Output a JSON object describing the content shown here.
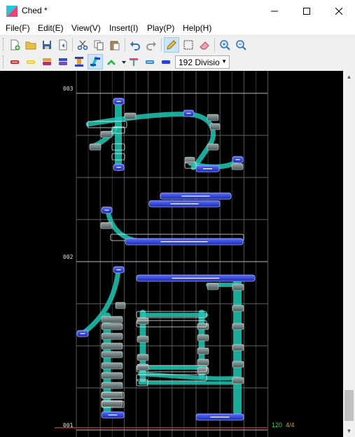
{
  "window": {
    "title": "Ched *"
  },
  "menu": {
    "items": [
      "File(F)",
      "Edit(E)",
      "View(V)",
      "Insert(I)",
      "Play(P)",
      "Help(H)"
    ]
  },
  "toolbar": {
    "division": "192 Divisio"
  },
  "score": {
    "measures": [
      "001",
      "002",
      "003"
    ],
    "bpm": "120",
    "time_signature": "4/4",
    "colors": {
      "bpm": "#4fd24f",
      "signature": "#e0a020",
      "slide": "#1ec8b4",
      "tap": "#2a3fd8",
      "beat_line": "#d02020"
    }
  }
}
